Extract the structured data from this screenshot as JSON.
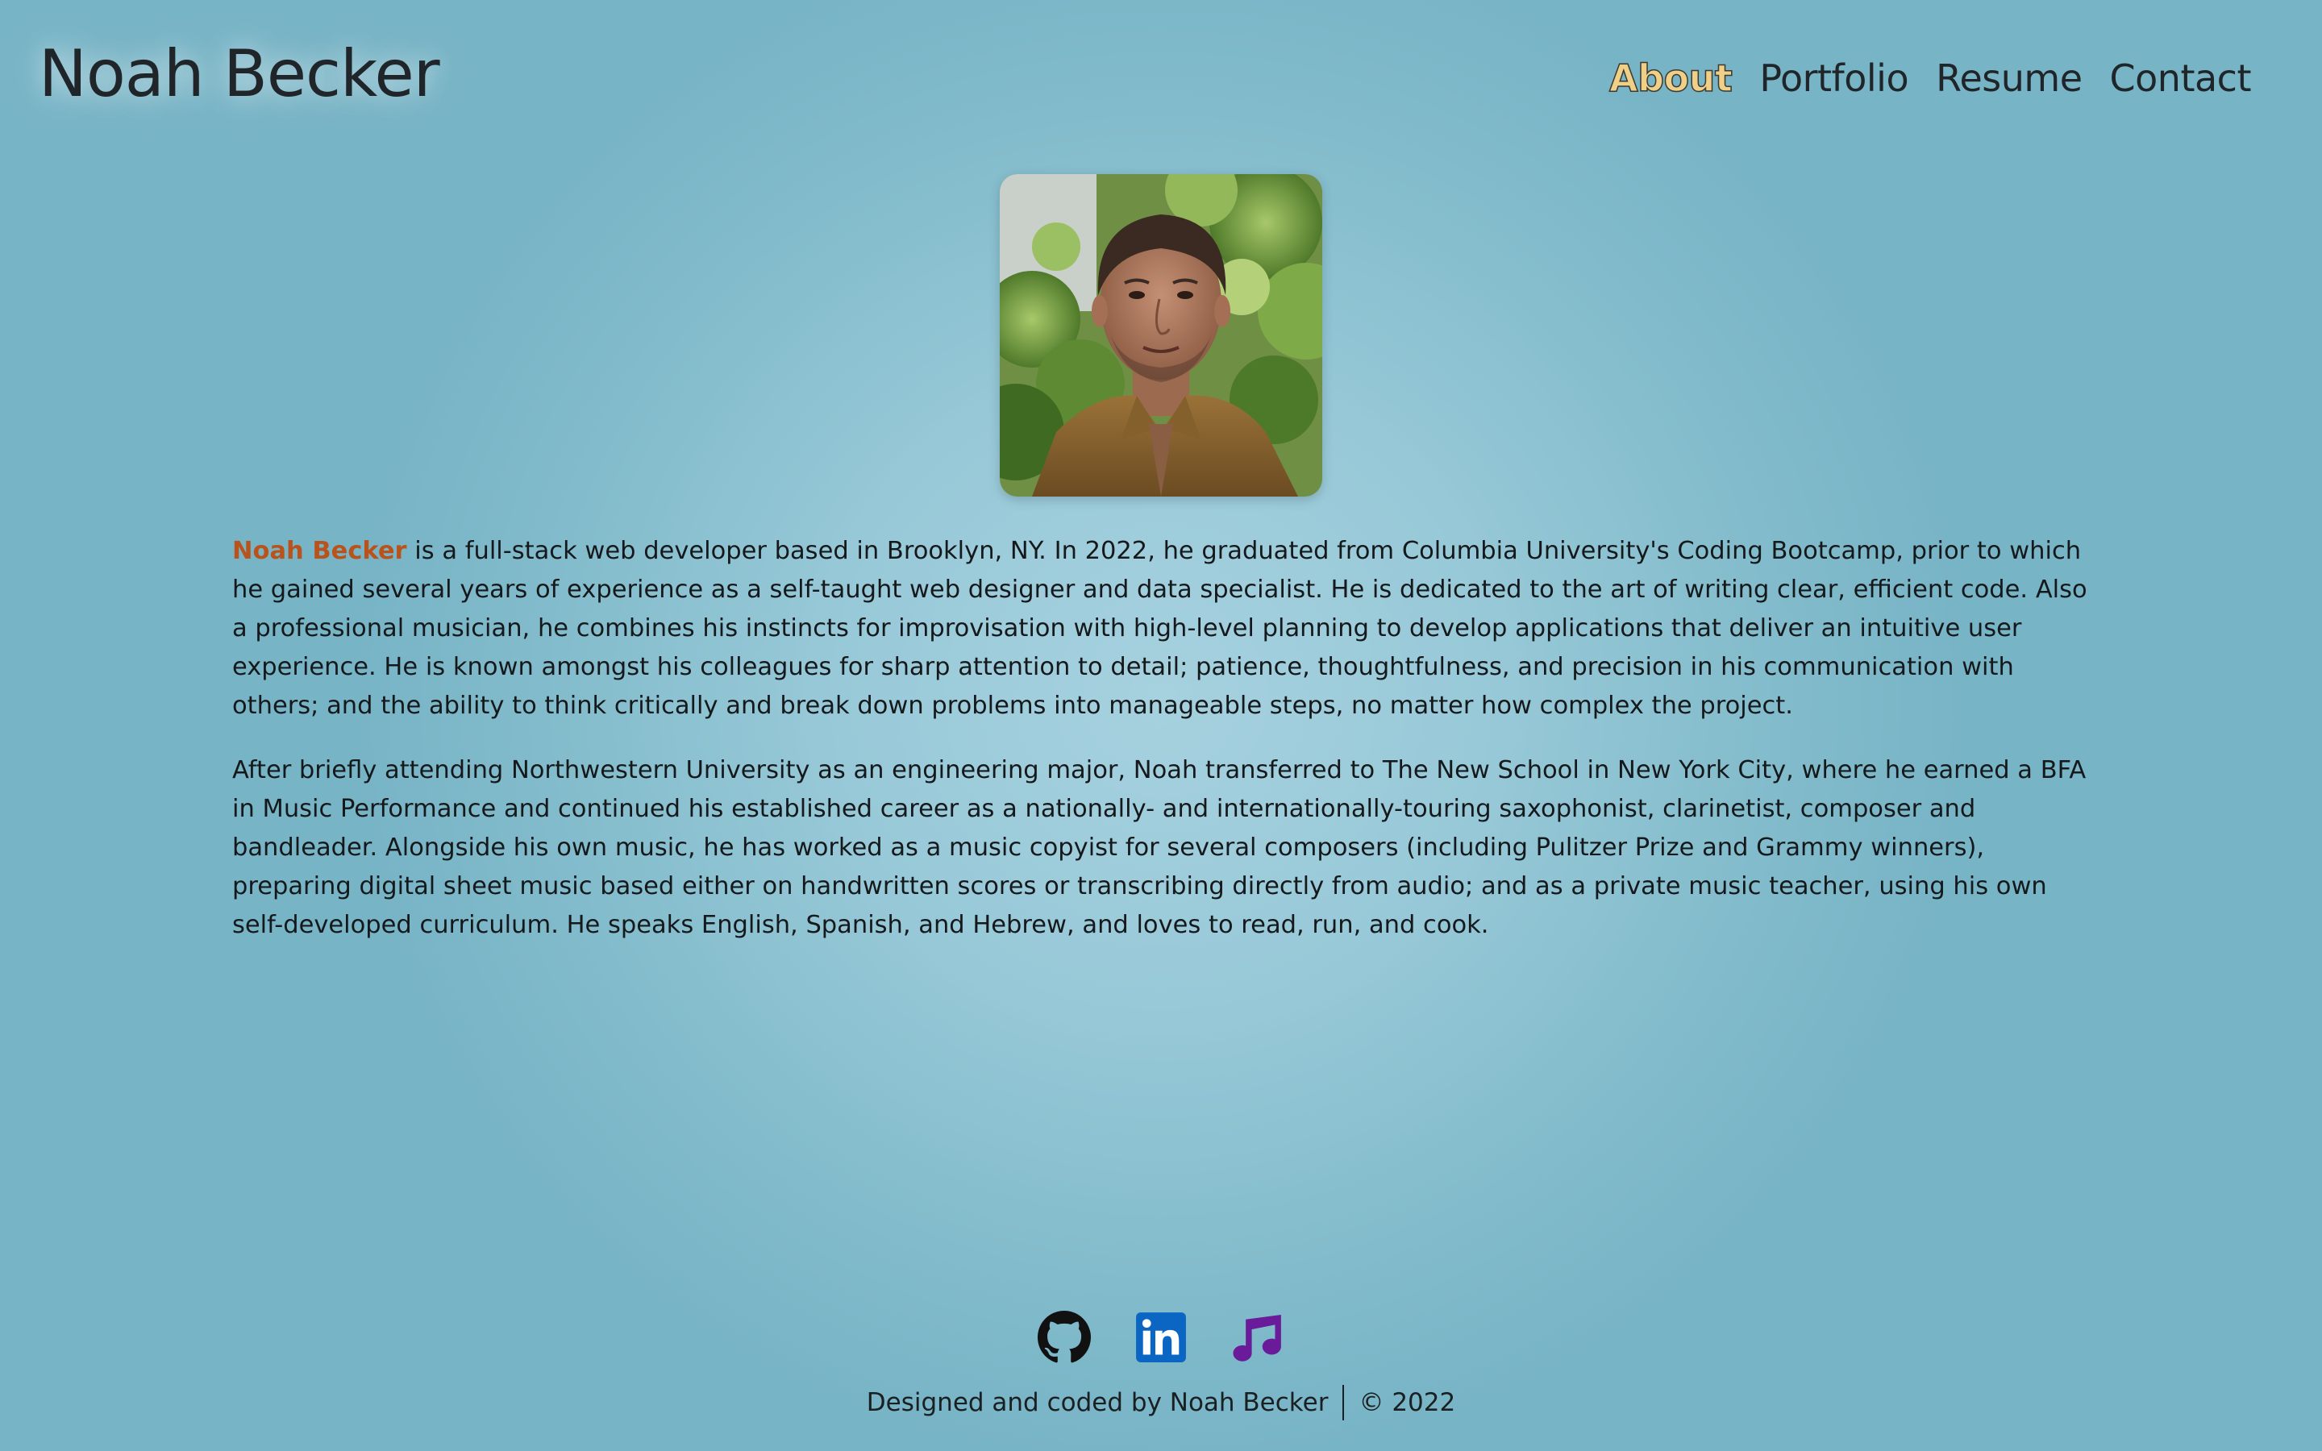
{
  "header": {
    "site_title": "Noah Becker",
    "nav": [
      {
        "label": "About",
        "active": true
      },
      {
        "label": "Portfolio",
        "active": false
      },
      {
        "label": "Resume",
        "active": false
      },
      {
        "label": "Contact",
        "active": false
      }
    ]
  },
  "profile": {
    "photo_icon": "portrait-photo"
  },
  "bio": {
    "name_highlight": "Noah Becker",
    "paragraph1_rest": " is a full-stack web developer based in Brooklyn, NY. In 2022, he graduated from Columbia University's Coding Bootcamp, prior to which he gained several years of experience as a self-taught web designer and data specialist. He is dedicated to the art of writing clear, efficient code. Also a professional musician, he combines his instincts for improvisation with high-level planning to develop applications that deliver an intuitive user experience. He is known amongst his colleagues for sharp attention to detail; patience, thoughtfulness, and precision in his communication with others; and the ability to think critically and break down problems into manageable steps, no matter how complex the project.",
    "paragraph2": "After briefly attending Northwestern University as an engineering major, Noah transferred to The New School in New York City, where he earned a BFA in Music Performance and continued his established career as a nationally- and internationally-touring saxophonist, clarinetist, composer and bandleader. Alongside his own music, he has worked as a music copyist for several composers (including Pulitzer Prize and Grammy winners), preparing digital sheet music based either on handwritten scores or transcribing directly from audio; and as a private music teacher, using his own self-developed curriculum. He speaks English, Spanish, and Hebrew, and loves to read, run, and cook."
  },
  "footer": {
    "social": [
      {
        "icon": "github-icon",
        "color": "#111111"
      },
      {
        "icon": "linkedin-icon",
        "color": "#0a66c2"
      },
      {
        "icon": "music-note-icon",
        "color": "#6a1b9a"
      }
    ],
    "credit_text": "Designed and coded by Noah Becker",
    "copyright": "© 2022"
  },
  "colors": {
    "accent_name": "#b9531b",
    "active_nav": "#f0cf87",
    "background": "#9ccbd9"
  }
}
